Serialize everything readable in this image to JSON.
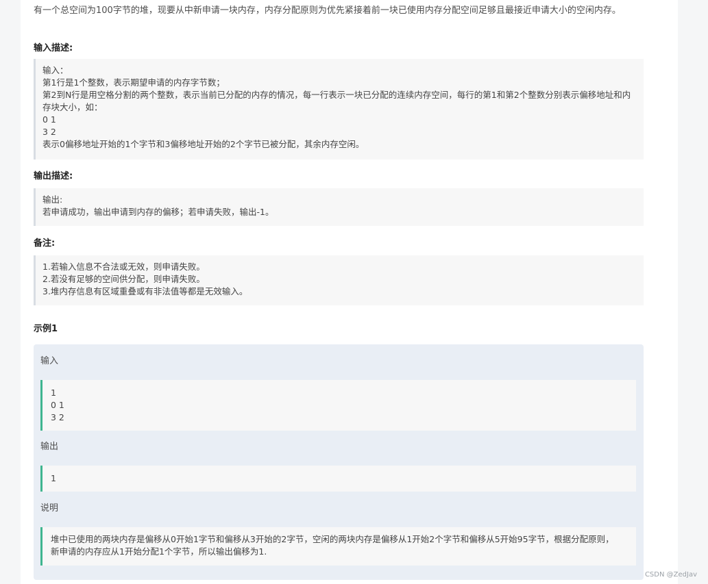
{
  "intro": "有一个总空间为100字节的堆，现要从中新申请一块内存，内存分配原则为优先紧接着前一块已使用内存分配空间足够且最接近申请大小的空闲内存。",
  "input_section": {
    "title": "输入描述:",
    "lines": [
      "输入：",
      "第1行是1个整数，表示期望申请的内存字节数；",
      "第2到N行是用空格分割的两个整数，表示当前已分配的内存的情况，每一行表示一块已分配的连续内存空间，每行的第1和第2个整数分别表示偏移地址和内存块大小，如：",
      "0 1",
      "3 2",
      "表示0偏移地址开始的1个字节和3偏移地址开始的2个字节已被分配，其余内存空闲。"
    ]
  },
  "output_section": {
    "title": "输出描述:",
    "lines": [
      "输出:",
      "若申请成功，输出申请到内存的偏移；若申请失败，输出-1。"
    ]
  },
  "notes_section": {
    "title": "备注:",
    "lines": [
      "1.若输入信息不合法或无效，则申请失败。",
      "2.若没有足够的空间供分配，则申请失败。",
      "3.堆内存信息有区域重叠或有非法值等都是无效输入。"
    ]
  },
  "example": {
    "title": "示例1",
    "input_label": "输入",
    "input_lines": [
      "1",
      "0 1",
      "3 2"
    ],
    "output_label": "输出",
    "output_lines": [
      "1"
    ],
    "explain_label": "说明",
    "explain_lines": [
      "堆中已使用的两块内存是偏移从0开始1字节和偏移从3开始的2字节，空闲的两块内存是偏移从1开始2个字节和偏移从5开始95字节，根据分配原则，",
      "新申请的内存应从1开始分配1个字节，所以输出偏移为1."
    ]
  },
  "watermark": "CSDN @ZedJav"
}
